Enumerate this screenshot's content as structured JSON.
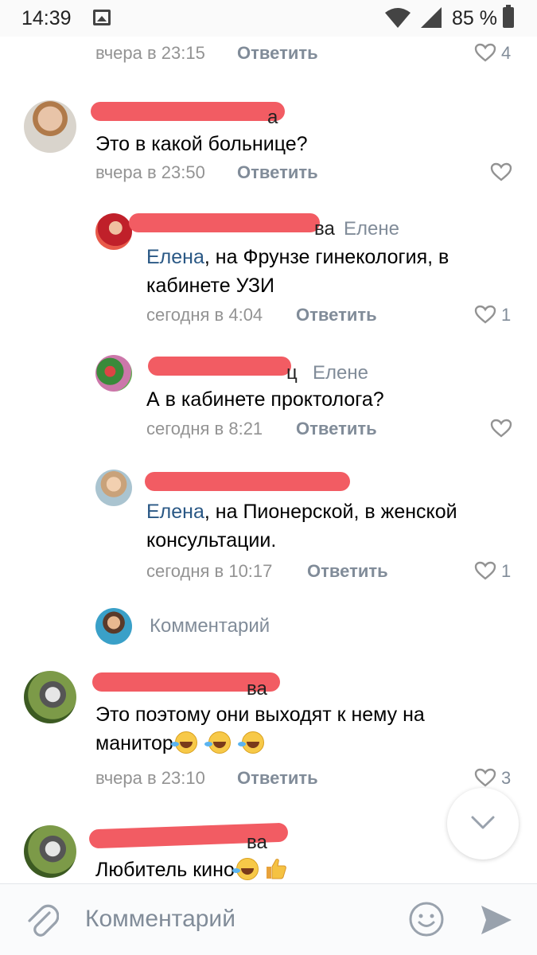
{
  "status_bar": {
    "time": "14:39",
    "battery": "85 %"
  },
  "comments": [
    {
      "meta": "вчера в 23:15",
      "reply": "Ответить",
      "likes": "4"
    },
    {
      "name_tail": "а",
      "text": "Это в какой больнице?",
      "meta": "вчера в 23:50",
      "reply": "Ответить",
      "likes": ""
    },
    {
      "name_tail": "ва",
      "reply_to": "Елене",
      "mention": "Елена",
      "text_line1": ", на Фрунзе гинекология, в",
      "text_line2": "кабинете УЗИ",
      "meta": "сегодня в 4:04",
      "reply": "Ответить",
      "likes": "1"
    },
    {
      "name_tail": "ц",
      "reply_to": "Елене",
      "text": "А в кабинете проктолога?",
      "meta": "сегодня в 8:21",
      "reply": "Ответить",
      "likes": ""
    },
    {
      "mention": "Елена",
      "text_line1": ", на Пионерской, в женской",
      "text_line2": "консультации.",
      "meta": "сегодня в 10:17",
      "reply": "Ответить",
      "likes": "1"
    },
    {
      "name_tail": "ва",
      "text_line1": "Это поэтому они выходят к нему на",
      "text_line2": "манитор",
      "meta": "вчера в 23:10",
      "reply": "Ответить",
      "likes": "3"
    },
    {
      "name_tail": "ва",
      "text": "Любитель кино"
    }
  ],
  "write_reply": {
    "placeholder": "Комментарий"
  },
  "bottom_bar": {
    "placeholder": "Комментарий"
  },
  "colors": {
    "redaction": "#f25c63",
    "link": "#2a5885",
    "muted": "#818c99"
  },
  "icons": [
    "image-icon",
    "wifi-icon",
    "signal-icon",
    "battery-icon",
    "heart-icon",
    "chevron-down-icon",
    "paperclip-icon",
    "smile-icon",
    "send-icon"
  ]
}
